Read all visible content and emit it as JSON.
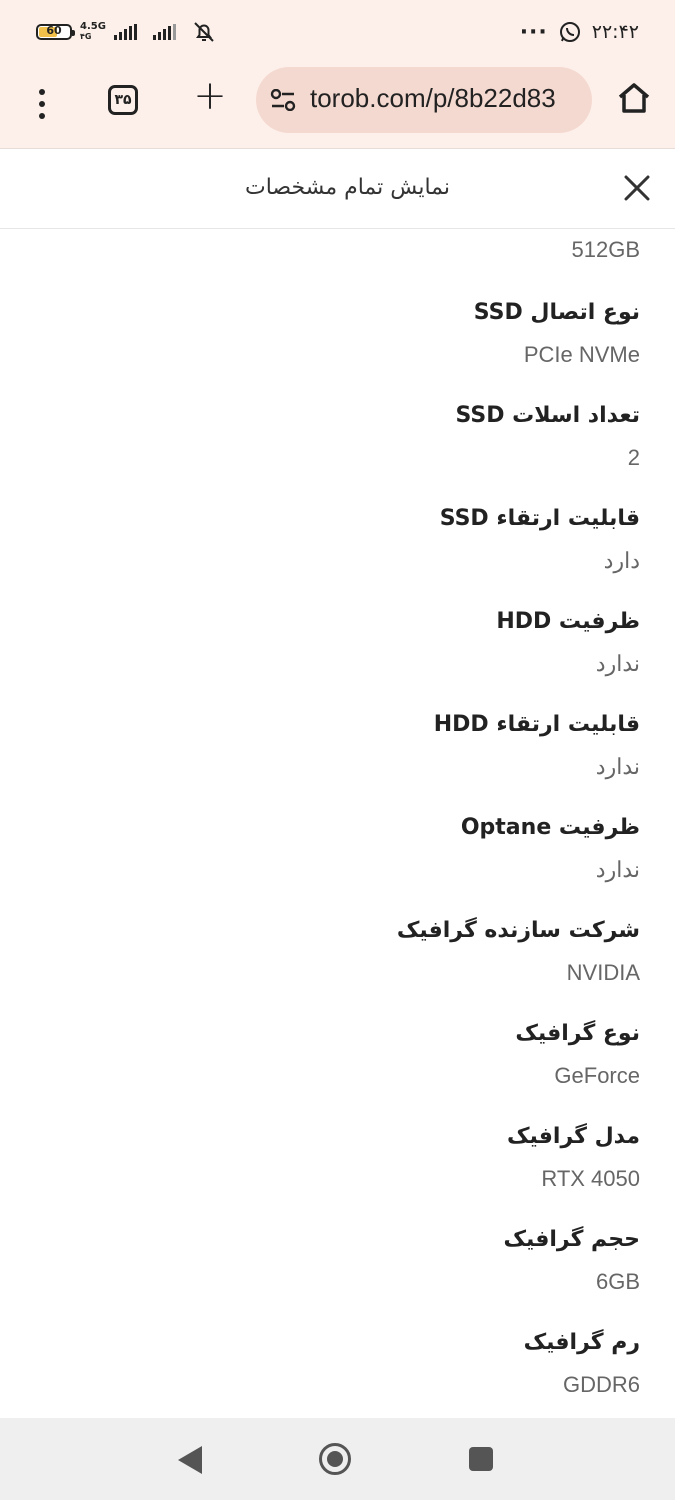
{
  "status_bar": {
    "battery": "60",
    "network": "4.5G",
    "network_sub": "۴G",
    "time": "۲۲:۴۲",
    "more": "···"
  },
  "browser": {
    "tab_count": "۳۵",
    "url": "torob.com/p/8b22d83"
  },
  "sheet": {
    "title": "نمایش تمام مشخصات"
  },
  "specs": {
    "first_value": "512GB",
    "items": [
      {
        "label": "نوع اتصال SSD",
        "value": "PCIe NVMe"
      },
      {
        "label": "تعداد اسلات SSD",
        "value": "2"
      },
      {
        "label": "قابلیت ارتقاء SSD",
        "value": "دارد"
      },
      {
        "label": "ظرفیت HDD",
        "value": "ندارد"
      },
      {
        "label": "قابلیت ارتقاء HDD",
        "value": "ندارد"
      },
      {
        "label": "ظرفیت Optane",
        "value": "ندارد"
      },
      {
        "label": "شرکت سازنده گرافیک",
        "value": "NVIDIA"
      },
      {
        "label": "نوع گرافیک",
        "value": "GeForce"
      },
      {
        "label": "مدل گرافیک",
        "value": "RTX 4050"
      },
      {
        "label": "حجم گرافیک",
        "value": "6GB"
      },
      {
        "label": "رم گرافیک",
        "value": "GDDR6"
      }
    ]
  },
  "icons": {
    "battery": "battery-icon",
    "signal": "signal-icon",
    "mute": "bell-off-icon",
    "whatsapp": "whatsapp-icon",
    "menu": "more-vertical-icon",
    "new_tab": "plus-icon",
    "site_settings": "tune-icon",
    "home": "home-icon",
    "close": "close-icon",
    "nav_back": "back-triangle-icon",
    "nav_home": "home-circle-icon",
    "nav_recent": "recent-square-icon"
  }
}
